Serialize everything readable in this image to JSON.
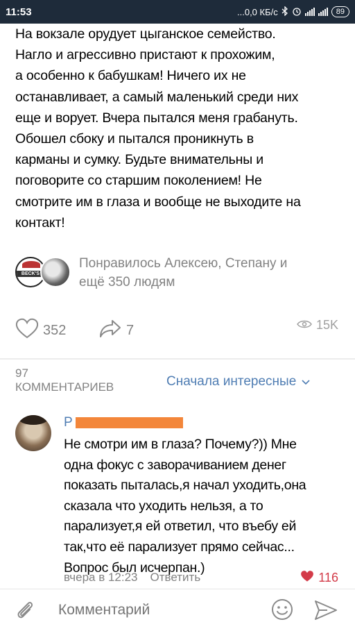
{
  "status_bar": {
    "time": "11:53",
    "net_speed": "...0,0 КБ/с",
    "battery": "89"
  },
  "post": {
    "lines": [
      "На вокзале орудует цыганское семейство.",
      "Нагло и агрессивно пристают к прохожим,",
      "а особенно к бабушкам! Ничего их не",
      "останавливает, а самый маленький среди них",
      "еще и ворует. Вчера пытался меня грабануть.",
      "Обошел сбоку и пытался проникнуть в",
      "карманы и сумку. Будьте внимательны и",
      "поговорите со старшим поколением! Не",
      "смотрите им в глаза и вообще не выходите на",
      "контакт!"
    ]
  },
  "likers": {
    "line1": "Понравилось Алексею, Степану и",
    "line2": "ещё 350 людям",
    "avatar1_text": "BECK'S"
  },
  "actions": {
    "likes": "352",
    "shares": "7",
    "views": "15K"
  },
  "comments_header": {
    "count": "97",
    "label": "КОММЕНТАРИЕВ",
    "sort": "Сначала интересные"
  },
  "comment": {
    "author_initial": "Р",
    "lines": [
      "Не смотри им в глаза? Почему?)) Мне",
      "одна фокус с заворачиванием денег",
      "показать пыталась,я начал уходить,она",
      "сказала что уходить нельзя, а то",
      "парализует,я ей ответил, что въебу ей",
      "так,что её парализует прямо сейчас...",
      "Вопрос был исчерпан.)"
    ],
    "time": "вчера в 12:23",
    "reply": "Ответить",
    "likes": "116"
  },
  "composer": {
    "placeholder": "Комментарий"
  },
  "colors": {
    "accent": "#4f7db3",
    "secondary_text": "#828282",
    "like_red": "#d33b49",
    "redaction": "#f3863a",
    "status_bar": "#1e2b3a"
  }
}
